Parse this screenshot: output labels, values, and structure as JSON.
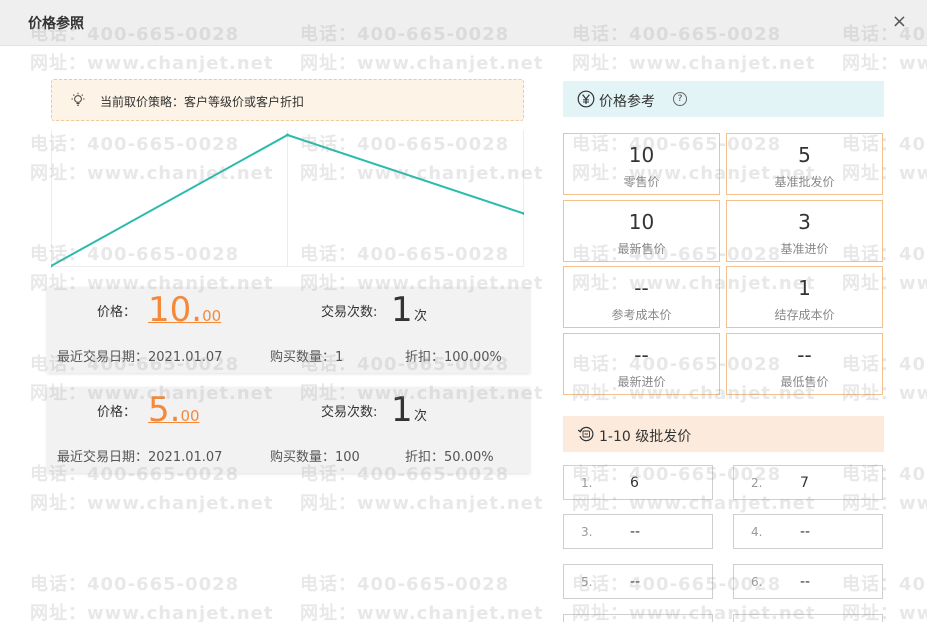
{
  "window": {
    "title": "价格参照",
    "close_icon": "close-icon",
    "close_label": "×"
  },
  "watermark": {
    "phone": "电话：400-665-0028",
    "site": "网址：www.chanjet.net"
  },
  "strategy": {
    "icon": "lightbulb-icon",
    "text": "当前取价策略：客户等级价或客户折扣"
  },
  "chart_data": {
    "type": "line",
    "x": [
      0,
      1,
      2
    ],
    "values": [
      5,
      10,
      7
    ],
    "color": "#2bbbad",
    "grid": true
  },
  "records": [
    {
      "price_label": "价格：",
      "price_int": "10.",
      "price_dec": "00",
      "count_label": "交易次数:",
      "count": "1",
      "count_unit": "次",
      "date": "最近交易日期：2021.01.07",
      "qty": "购买数量：1",
      "discount": "折扣：100.00%"
    },
    {
      "price_label": "价格：",
      "price_int": "5.",
      "price_dec": "00",
      "count_label": "交易次数:",
      "count": "1",
      "count_unit": "次",
      "date": "最近交易日期：2021.01.07",
      "qty": "购买数量：100",
      "discount": "折扣：50.00%"
    }
  ],
  "reference": {
    "title": "价格参考",
    "icon": "yen-circle-icon",
    "help_icon": "help-icon",
    "help_symbol": "?",
    "items": [
      {
        "value": "10",
        "name": "零售价"
      },
      {
        "value": "5",
        "name": "基准批发价"
      },
      {
        "value": "10",
        "name": "最新售价"
      },
      {
        "value": "3",
        "name": "基准进价"
      },
      {
        "value": "--",
        "name": "参考成本价"
      },
      {
        "value": "1",
        "name": "结存成本价"
      },
      {
        "value": "--",
        "name": "最新进价"
      },
      {
        "value": "--",
        "name": "最低售价"
      }
    ]
  },
  "wholesale": {
    "title": "1-10 级批发价",
    "icon": "wholesale-level-icon",
    "items": [
      {
        "index": "1.",
        "value": "6"
      },
      {
        "index": "2.",
        "value": "7"
      },
      {
        "index": "3.",
        "value": "--"
      },
      {
        "index": "4.",
        "value": "--"
      },
      {
        "index": "5.",
        "value": "--"
      },
      {
        "index": "6.",
        "value": "--"
      }
    ]
  }
}
